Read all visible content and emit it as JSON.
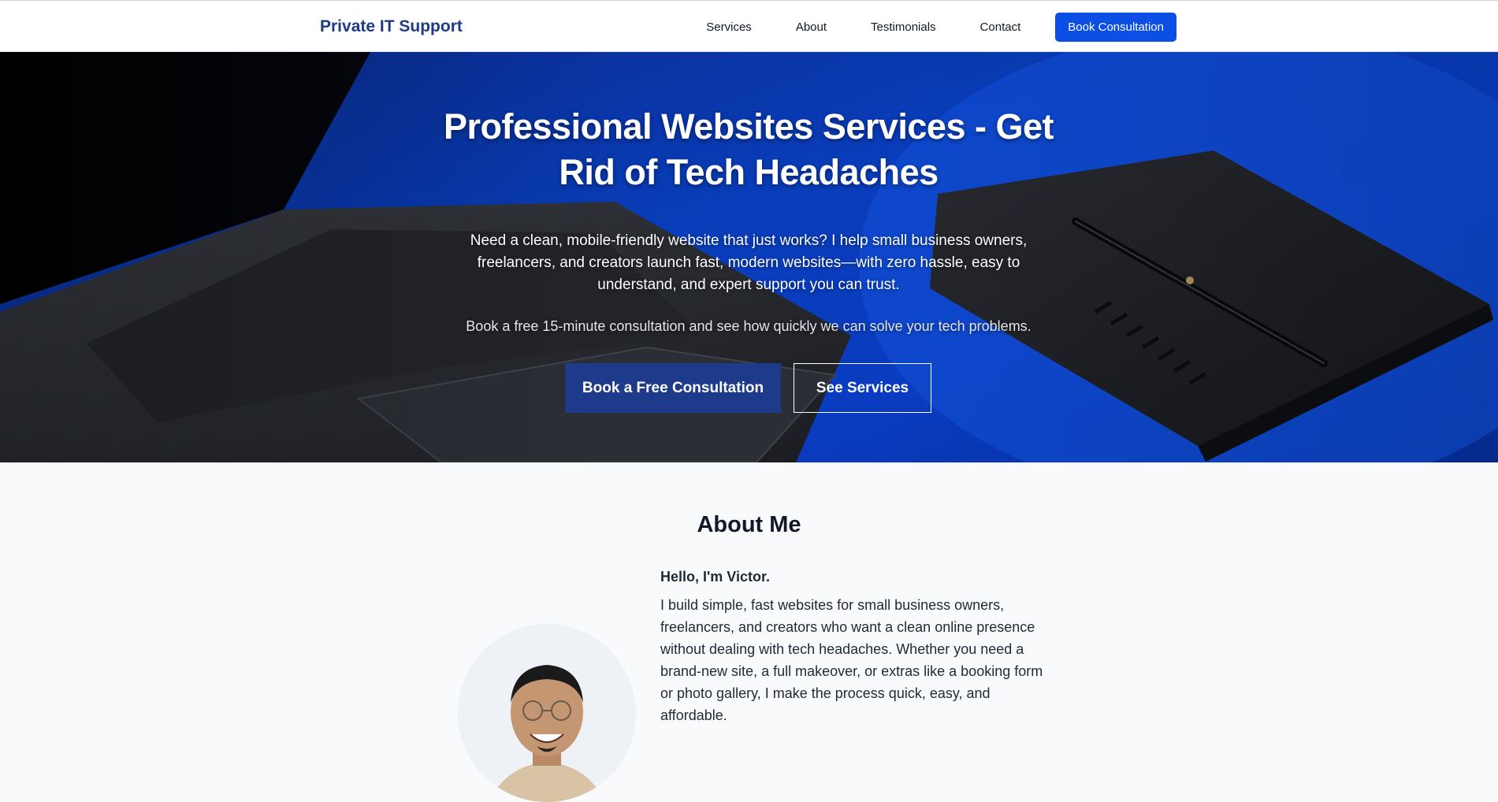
{
  "nav": {
    "brand": "Private IT Support",
    "links": [
      "Services",
      "About",
      "Testimonials",
      "Contact"
    ],
    "cta": "Book Consultation"
  },
  "hero": {
    "title": "Professional Websites Services - Get Rid of Tech Headaches",
    "subtitle": "Need a clean, mobile-friendly website that just works? I help small business owners, freelancers, and creators launch fast, modern websites—with zero hassle, easy to understand, and expert support you can trust.",
    "note": "Book a free 15-minute consultation and see how quickly we can solve your tech problems.",
    "primary_button": "Book a Free Consultation",
    "secondary_button": "See Services"
  },
  "about": {
    "title": "About Me",
    "hello": "Hello, I'm Victor.",
    "text": "I build simple, fast websites for small business owners, freelancers, and creators who want a clean online presence without dealing with tech headaches. Whether you need a brand-new site, a full makeover, or extras like a booking form or photo gallery, I make the process quick, easy, and affordable."
  },
  "colors": {
    "brand": "#1e3a8a",
    "cta": "#0b4fe5",
    "hero_blue": "#0940c4"
  }
}
